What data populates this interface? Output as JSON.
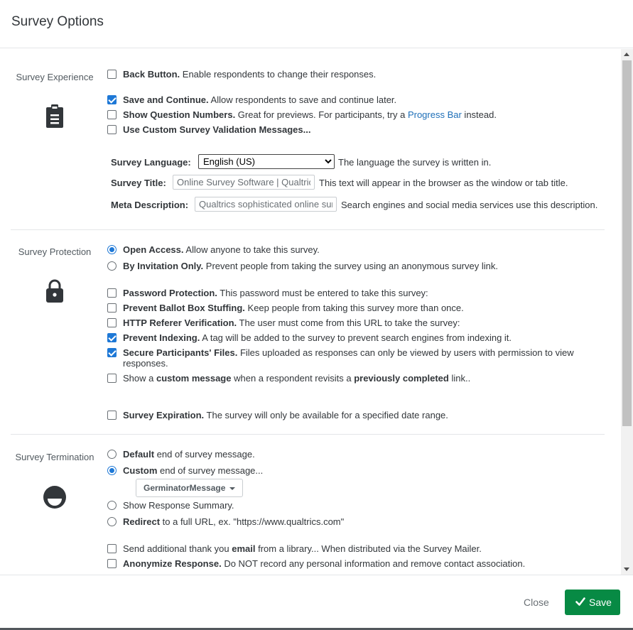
{
  "header": {
    "title": "Survey Options"
  },
  "experience": {
    "label": "Survey Experience",
    "icon": "clipboard-icon",
    "back_button": {
      "checked": false,
      "bold": "Back Button.",
      "text": " Enable respondents to change their responses."
    },
    "save_continue": {
      "checked": true,
      "bold": "Save and Continue.",
      "text": " Allow respondents to save and continue later."
    },
    "question_numbers": {
      "checked": false,
      "bold": "Show Question Numbers.",
      "text_before": " Great for previews. For participants, try a ",
      "link": "Progress Bar",
      "text_after": " instead."
    },
    "custom_validation": {
      "checked": false,
      "bold": "Use Custom Survey Validation Messages..."
    },
    "language": {
      "label": "Survey Language:",
      "value": "English (US)",
      "desc": "The language the survey is written in."
    },
    "title_field": {
      "label": "Survey Title:",
      "value": "Online Survey Software | Qualtrics Survey Solutions",
      "desc": "This text will appear in the browser as the window or tab title."
    },
    "meta": {
      "label": "Meta Description:",
      "value": "Qualtrics sophisticated online survey software",
      "desc": "Search engines and social media services use this description."
    }
  },
  "protection": {
    "label": "Survey Protection",
    "icon": "lock-icon",
    "open_access": {
      "checked": true,
      "bold": "Open Access.",
      "text": " Allow anyone to take this survey."
    },
    "by_invitation": {
      "checked": false,
      "bold": "By Invitation Only.",
      "text": " Prevent people from taking the survey using an anonymous survey link."
    },
    "password": {
      "checked": false,
      "bold": "Password Protection.",
      "text": " This password must be entered to take this survey:"
    },
    "ballot_box": {
      "checked": false,
      "bold": "Prevent Ballot Box Stuffing.",
      "text": " Keep people from taking this survey more than once."
    },
    "http_referer": {
      "checked": false,
      "bold": "HTTP Referer Verification.",
      "text": " The user must come from this URL to take the survey:"
    },
    "prevent_indexing": {
      "checked": true,
      "bold": "Prevent Indexing.",
      "text": " A tag will be added to the survey to prevent search engines from indexing it."
    },
    "secure_files": {
      "checked": true,
      "bold": "Secure Participants' Files.",
      "text": " Files uploaded as responses can only be viewed by users with permission to view responses."
    },
    "custom_message": {
      "checked": false,
      "t1": "Show a ",
      "b1": "custom message",
      "t2": " when a respondent revisits a ",
      "b2": "previously completed",
      "t3": " link.."
    },
    "expiration": {
      "checked": false,
      "bold": "Survey Expiration.",
      "text": " The survey will only be available for a specified date range."
    }
  },
  "termination": {
    "label": "Survey Termination",
    "icon": "end-of-survey-icon",
    "default_msg": {
      "checked": false,
      "bold": "Default",
      "text": " end of survey message."
    },
    "custom_msg": {
      "checked": true,
      "bold": "Custom",
      "text": " end of survey message..."
    },
    "message_dropdown": "GerminatorMessage",
    "response_summary": {
      "checked": false,
      "text": "Show Response Summary."
    },
    "redirect": {
      "checked": false,
      "bold": "Redirect",
      "text": " to a full URL, ex. \"https://www.qualtrics.com\""
    },
    "thank_you_email": {
      "checked": false,
      "t1": "Send additional thank you ",
      "b1": "email",
      "t2": " from a library... When distributed via the Survey Mailer."
    },
    "anonymize": {
      "checked": false,
      "bold": "Anonymize Response.",
      "text": " Do NOT record any personal information and remove contact association."
    }
  },
  "footer": {
    "close_label": "Close",
    "save_label": "Save"
  },
  "colors": {
    "accent": "#1e78d6",
    "save": "#078a44",
    "link": "#1e6fb8"
  }
}
